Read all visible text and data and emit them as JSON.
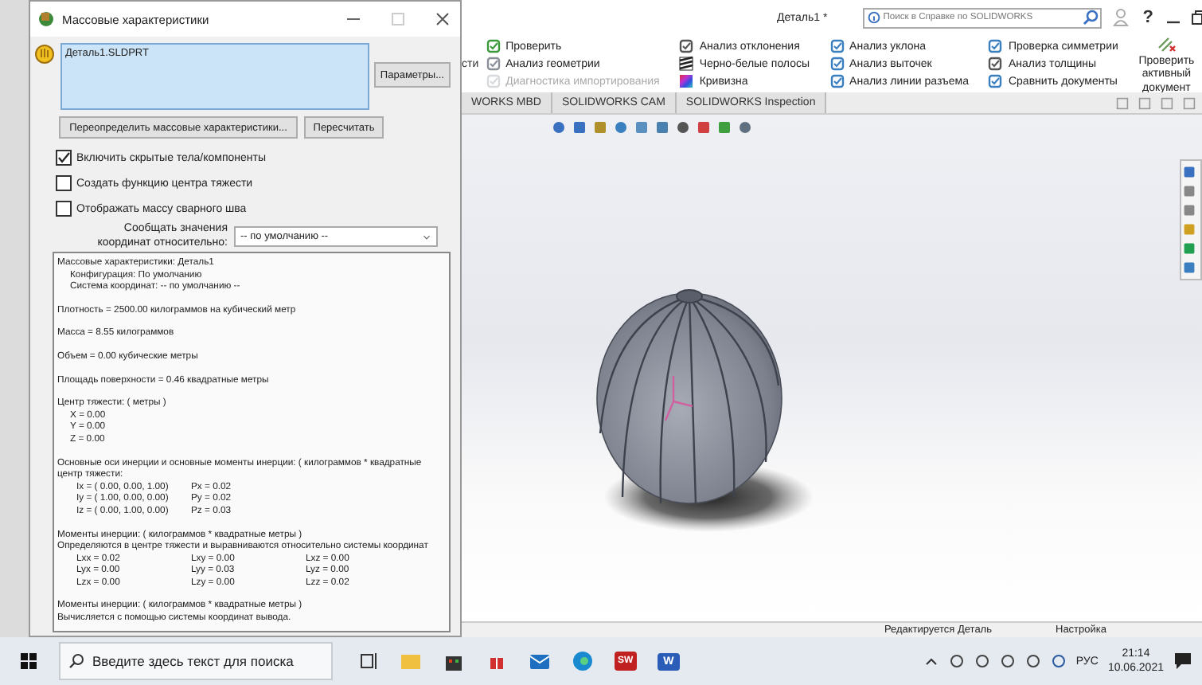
{
  "app": {
    "title": "Деталь1 *",
    "help_search": {
      "placeholder": "Поиск в Справке по SOLIDWORKS"
    },
    "help_button": "?",
    "ribbon_fragment": "сти",
    "ribbon_columns": [
      [
        {
          "label": "Проверить",
          "disabled": false
        },
        {
          "label": "Анализ геометрии",
          "disabled": false
        },
        {
          "label": "Диагностика импортирования",
          "disabled": true
        }
      ],
      [
        {
          "label": "Анализ отклонения",
          "disabled": false
        },
        {
          "label": "Черно-белые полосы",
          "disabled": false
        },
        {
          "label": "Кривизна",
          "disabled": false
        }
      ],
      [
        {
          "label": "Анализ уклона",
          "disabled": false
        },
        {
          "label": "Анализ выточек",
          "disabled": false
        },
        {
          "label": "Анализ линии разъема",
          "disabled": false
        }
      ],
      [
        {
          "label": "Проверка симметрии",
          "disabled": false
        },
        {
          "label": "Анализ толщины",
          "disabled": false
        },
        {
          "label": "Сравнить документы",
          "disabled": false
        }
      ]
    ],
    "big_button": "Проверить активный документ",
    "tabs": [
      {
        "label": "WORKS MBD",
        "selected": false
      },
      {
        "label": "SOLIDWORKS CAM",
        "selected": false
      },
      {
        "label": "SOLIDWORKS Inspection",
        "selected": false
      }
    ],
    "status": [
      "Редактируется Деталь",
      "Настройка"
    ]
  },
  "dialog": {
    "title": "Массовые характеристики",
    "selection_list": [
      "Деталь1.SLDPRT"
    ],
    "options_button": "Параметры...",
    "override_button": "Переопределить массовые характеристики...",
    "recalculate_button": "Пересчитать",
    "checkboxes": [
      {
        "label": "Включить скрытые тела/компоненты",
        "checked": true
      },
      {
        "label": "Создать функцию центра тяжести",
        "checked": false
      },
      {
        "label": "Отображать массу сварного шва",
        "checked": false
      }
    ],
    "coordinate_label": "Сообщать значения координат относительно:",
    "coordinate_select": "-- по умолчанию --",
    "results": [
      {
        "lines": [
          {
            "kind": "text",
            "text": "Массовые характеристики: Деталь1",
            "indent": false
          },
          {
            "kind": "text",
            "text": "Конфигурация: По умолчанию",
            "indent": true
          },
          {
            "kind": "text",
            "text": "Система координат: -- по умолчанию --",
            "indent": true
          }
        ]
      },
      {
        "lines": [
          {
            "kind": "text",
            "text": "Плотность = 2500.00 килограммов на кубический метр",
            "indent": false
          }
        ]
      },
      {
        "lines": [
          {
            "kind": "text",
            "text": "Масса = 8.55 килограммов",
            "indent": false
          }
        ]
      },
      {
        "lines": [
          {
            "kind": "text",
            "text": "Объем = 0.00 кубические метры",
            "indent": false
          }
        ]
      },
      {
        "lines": [
          {
            "kind": "text",
            "text": "Площадь поверхности = 0.46 квадратные метры",
            "indent": false
          }
        ]
      },
      {
        "lines": [
          {
            "kind": "text",
            "text": "Центр тяжести: ( метры )",
            "indent": false
          },
          {
            "kind": "text",
            "text": "X = 0.00",
            "indent": true
          },
          {
            "kind": "text",
            "text": "Y = 0.00",
            "indent": true
          },
          {
            "kind": "text",
            "text": "Z = 0.00",
            "indent": true
          }
        ]
      },
      {
        "lines": [
          {
            "kind": "text",
            "text": "Основные оси инерции и основные моменты инерции: ( килограммов * квадратные",
            "indent": false
          },
          {
            "kind": "text",
            "text": "центр тяжести:",
            "indent": false
          },
          {
            "kind": "cells",
            "cells": [
              "Ix = ( 0.00,  0.00,  1.00)",
              "Px = 0.02"
            ]
          },
          {
            "kind": "cells",
            "cells": [
              "Iy = ( 1.00,  0.00,  0.00)",
              "Py = 0.02"
            ]
          },
          {
            "kind": "cells",
            "cells": [
              "Iz = ( 0.00,  1.00,  0.00)",
              "Pz = 0.03"
            ]
          }
        ]
      },
      {
        "lines": [
          {
            "kind": "text",
            "text": "Моменты инерции: ( килограммов * квадратные метры )",
            "indent": false
          },
          {
            "kind": "text",
            "text": "Определяются в центре тяжести и выравниваются относительно системы координат",
            "indent": false
          },
          {
            "kind": "cells",
            "cells": [
              "Lxx = 0.02",
              "Lxy = 0.00",
              "Lxz = 0.00"
            ]
          },
          {
            "kind": "cells",
            "cells": [
              "Lyx = 0.00",
              "Lyy = 0.03",
              "Lyz = 0.00"
            ]
          },
          {
            "kind": "cells",
            "cells": [
              "Lzx = 0.00",
              "Lzy = 0.00",
              "Lzz = 0.02"
            ]
          }
        ]
      },
      {
        "lines": [
          {
            "kind": "text",
            "text": "Моменты инерции: ( килограммов * квадратные метры )",
            "indent": false
          },
          {
            "kind": "text",
            "text": "Вычисляется с помощью системы координат вывода.",
            "indent": false
          }
        ]
      }
    ]
  },
  "taskbar": {
    "search": {
      "placeholder": "Введите здесь текст для поиска"
    },
    "solidworks_badge": "SW",
    "word_badge": "W",
    "language": "РУС",
    "time": "21:14",
    "date": "10.06.2021"
  }
}
